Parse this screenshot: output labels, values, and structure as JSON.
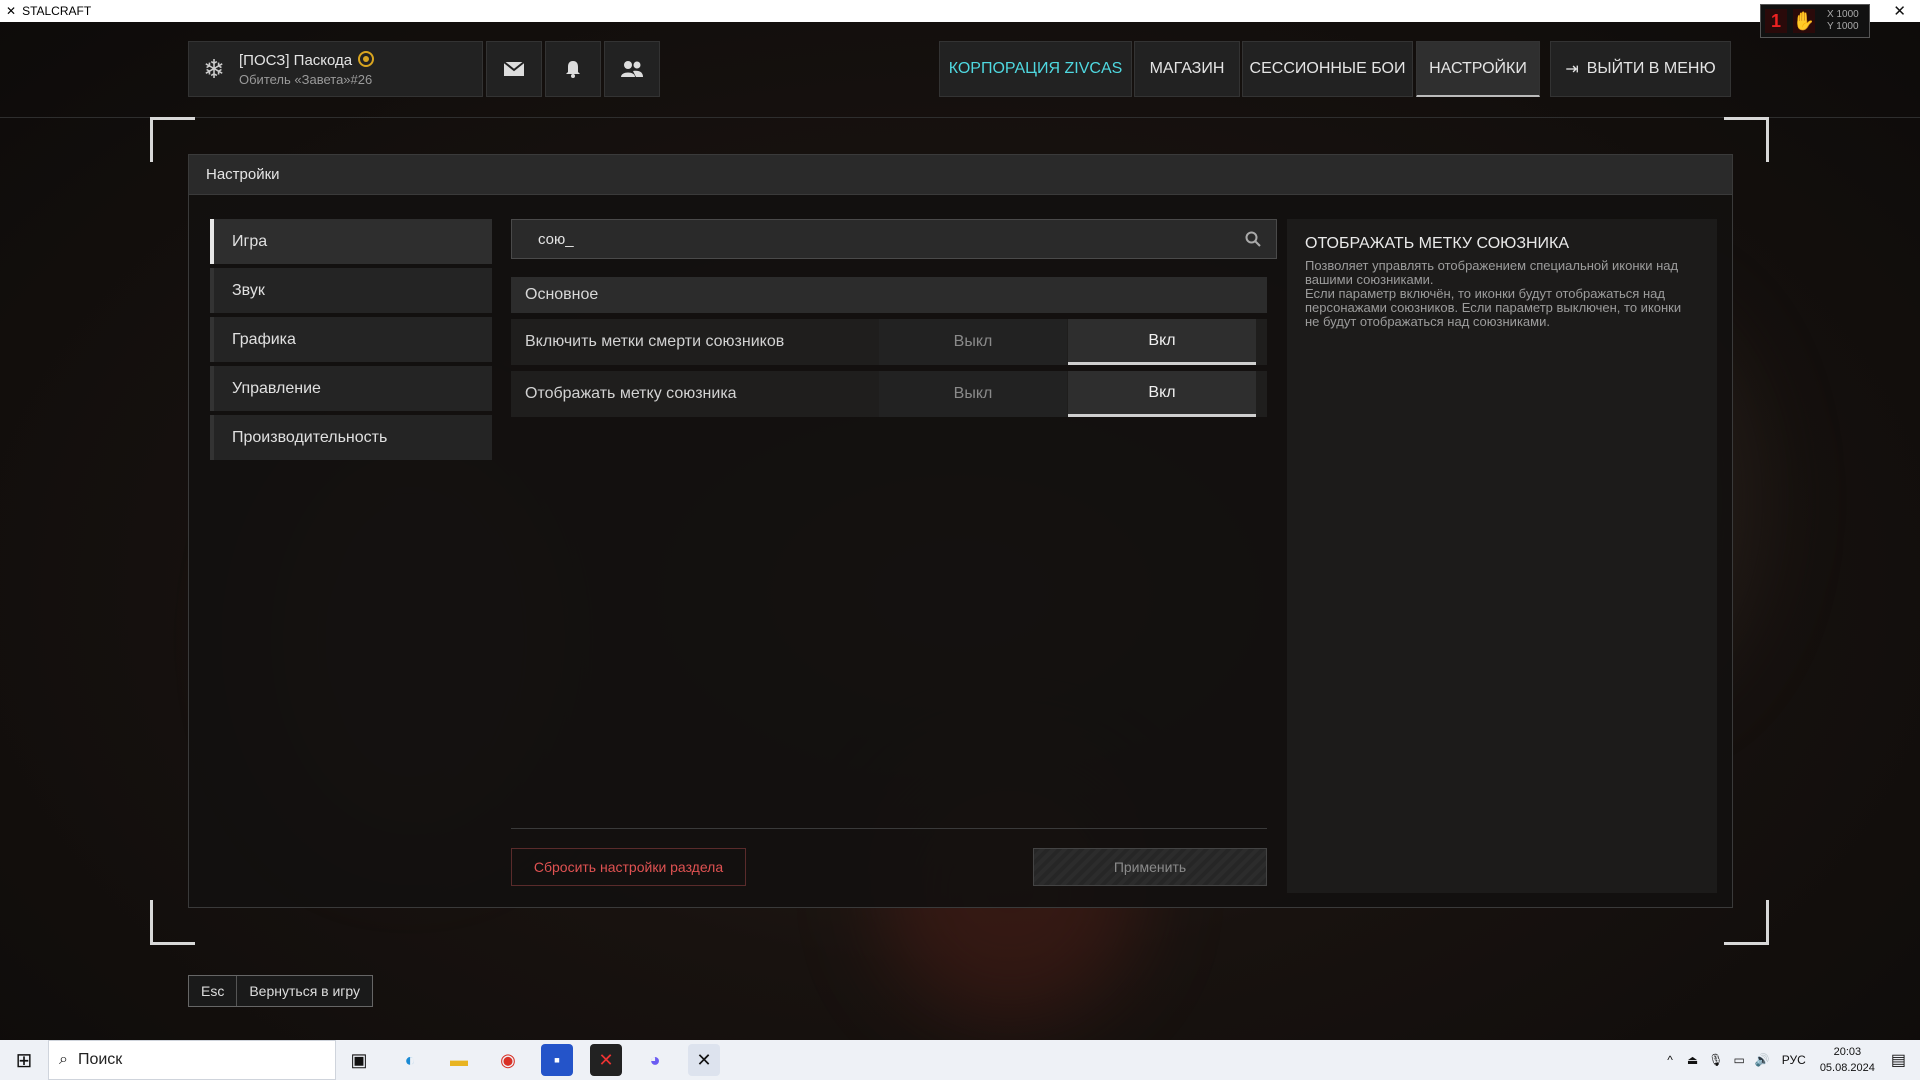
{
  "window": {
    "title": "STALCRAFT"
  },
  "hud": {
    "badge": "1",
    "x": "X 1000",
    "y": "Y 1000"
  },
  "profile": {
    "name": "[ПОСЗ] Паскода",
    "subtitle": "Обитель «Завета»#26"
  },
  "nav": {
    "corp": "КОРПОРАЦИЯ ZIVCAS",
    "shop": "МАГАЗИН",
    "sessions": "СЕССИОННЫЕ БОИ",
    "settings": "НАСТРОЙКИ",
    "exit": "ВЫЙТИ В МЕНЮ"
  },
  "panel": {
    "title": "Настройки"
  },
  "tabs": [
    "Игра",
    "Звук",
    "Графика",
    "Управление",
    "Производительность"
  ],
  "search": {
    "value": "сою_"
  },
  "section": {
    "title": "Основное"
  },
  "settings": [
    {
      "label": "Включить метки смерти союзников",
      "off": "Выкл",
      "on": "Вкл",
      "selected": "on"
    },
    {
      "label": "Отображать метку союзника",
      "off": "Выкл",
      "on": "Вкл",
      "selected": "on"
    }
  ],
  "description": {
    "title": "ОТОБРАЖАТЬ МЕТКУ СОЮЗНИКА",
    "line1": "Позволяет управлять отображением специальной иконки над вашими союзниками.",
    "line2": "Если параметр включён, то иконки будут отображаться над персонажами союзников. Если параметр выключен, то иконки не будут отображаться над союзниками."
  },
  "buttons": {
    "reset": "Сбросить настройки раздела",
    "apply": "Применить"
  },
  "footer": {
    "esc": "Esc",
    "back": "Вернуться в игру"
  },
  "taskbar": {
    "search": "Поиск",
    "lang": "РУС",
    "time": "20:03",
    "date": "05.08.2024"
  },
  "colors": {
    "accent_corp": "#4fd8e0",
    "reset_red": "#e05252"
  }
}
